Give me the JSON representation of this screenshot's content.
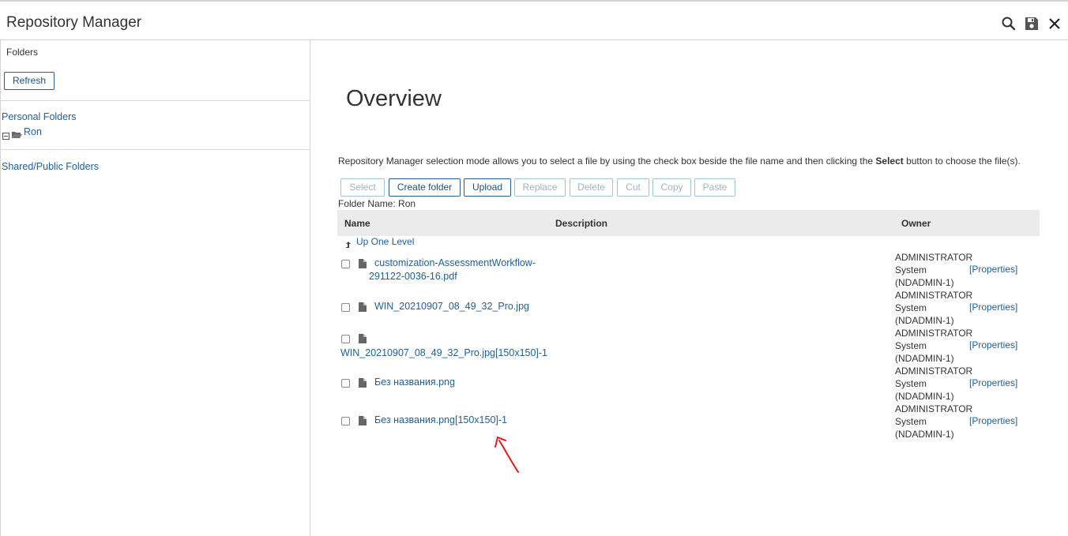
{
  "app": {
    "title": "Repository Manager"
  },
  "sidebar": {
    "folders_label": "Folders",
    "refresh_label": "Refresh",
    "personal_folders": "Personal Folders",
    "tree_item": "Ron",
    "shared_folders": "Shared/Public Folders"
  },
  "main": {
    "heading": "Overview",
    "intro_pre": "Repository Manager selection mode allows you to select a file by using the check box beside the file name and then clicking the ",
    "intro_bold": "Select",
    "intro_post": " button to choose the file(s).",
    "folder_name": "Folder Name: Ron"
  },
  "toolbar": {
    "select": "Select",
    "create_folder": "Create folder",
    "upload": "Upload",
    "replace": "Replace",
    "delete": "Delete",
    "cut": "Cut",
    "copy": "Copy",
    "paste": "Paste"
  },
  "table": {
    "headers": {
      "name": "Name",
      "description": "Description",
      "owner": "Owner"
    },
    "up_one_level": "Up One Level",
    "rows": [
      {
        "name_line1": "customization-AssessmentWorkflow-",
        "name_line2": "291122-0036-16.pdf",
        "owner1": "ADMINISTRATOR",
        "owner2": "System",
        "owner3": "(NDADMIN-1)",
        "properties": "[Properties]"
      },
      {
        "name_line1": "WIN_20210907_08_49_32_Pro.jpg",
        "owner1": "ADMINISTRATOR",
        "owner2": "System",
        "owner3": "(NDADMIN-1)",
        "properties": "[Properties]"
      },
      {
        "name_line1": "WIN_20210907_08_49_32_Pro.jpg[150x150]-1",
        "owner1": "ADMINISTRATOR",
        "owner2": "System",
        "owner3": "(NDADMIN-1)",
        "properties": "[Properties]"
      },
      {
        "name_line1": "Без названия.png",
        "owner1": "ADMINISTRATOR",
        "owner2": "System",
        "owner3": "(NDADMIN-1)",
        "properties": "[Properties]"
      },
      {
        "name_line1": "Без названия.png[150x150]-1",
        "owner1": "ADMINISTRATOR",
        "owner2": "System",
        "owner3": "(NDADMIN-1)",
        "properties": "[Properties]"
      }
    ]
  },
  "colors": {
    "link": "#1f5f9a",
    "annotation_arrow": "#e0191c",
    "header_bg": "#ebebeb"
  },
  "icons": {
    "search": "search-icon",
    "save": "save-icon",
    "close": "close-icon",
    "collapse": "minus-square-icon",
    "folder": "folder-open-icon",
    "up": "up-arrow-icon",
    "file": "file-icon"
  }
}
